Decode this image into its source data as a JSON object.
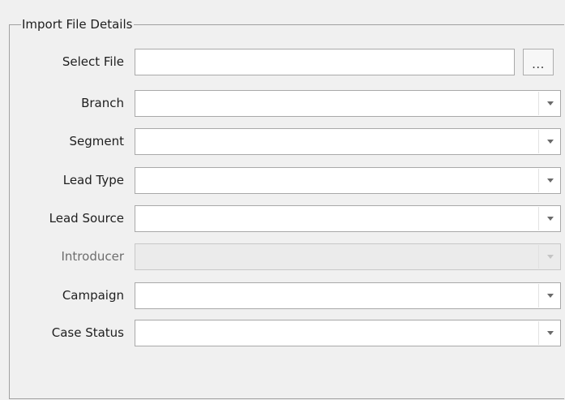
{
  "group": {
    "title": "Import File Details"
  },
  "fields": {
    "select_file": {
      "label": "Select File",
      "value": "",
      "browse_label": "..."
    },
    "branch": {
      "label": "Branch",
      "value": ""
    },
    "segment": {
      "label": "Segment",
      "value": ""
    },
    "lead_type": {
      "label": "Lead Type",
      "value": ""
    },
    "lead_source": {
      "label": "Lead Source",
      "value": ""
    },
    "introducer": {
      "label": "Introducer",
      "value": "",
      "enabled": false
    },
    "campaign": {
      "label": "Campaign",
      "value": ""
    },
    "case_status": {
      "label": "Case Status",
      "value": ""
    }
  },
  "icons": {
    "dropdown": "chevron-down-icon"
  },
  "colors": {
    "background": "#f0f0f0",
    "field_border": "#a9a9a9",
    "disabled_field": "#ebebeb"
  }
}
